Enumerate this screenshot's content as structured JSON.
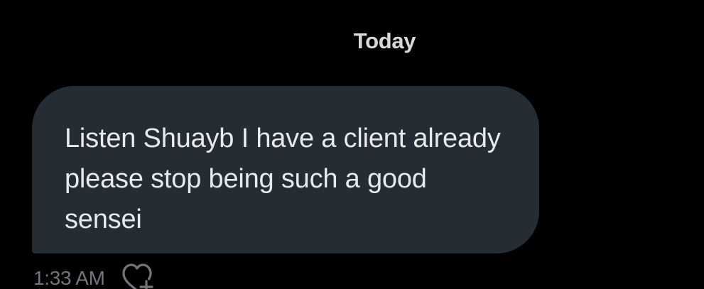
{
  "conversation": {
    "date_divider": "Today"
  },
  "message": {
    "text": "Listen Shuayb I have a client already please stop being such a good sensei",
    "timestamp": "1:33 AM",
    "react_icon": "heart-plus-icon"
  },
  "colors": {
    "background": "#000000",
    "bubble": "#242d34",
    "message_text": "#e7e9ea",
    "meta_text": "#71767b"
  }
}
